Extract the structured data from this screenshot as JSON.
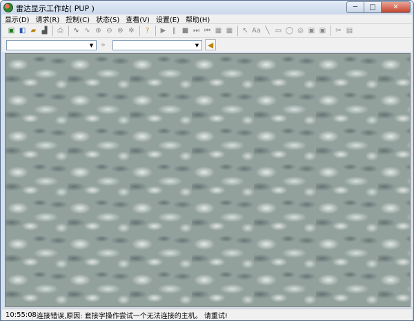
{
  "window": {
    "title": "雷达显示工作站( PUP )",
    "buttons": {
      "minimize": "─",
      "maximize": "□",
      "close": "✕"
    }
  },
  "menu": [
    "显示(D)",
    "请求(R)",
    "控制(C)",
    "状态(S)",
    "查看(V)",
    "设置(E)",
    "帮助(H)"
  ],
  "toolbar": [
    {
      "icon": "open-icon",
      "glyph": "▣"
    },
    {
      "icon": "connect-icon",
      "glyph": "◧"
    },
    {
      "icon": "folder-icon",
      "glyph": "▰"
    },
    {
      "icon": "chart-icon",
      "glyph": "▟"
    },
    {
      "icon": "print-icon",
      "glyph": "⎙"
    },
    {
      "icon": "waveform-icon",
      "glyph": "∿"
    },
    {
      "icon": "waveform-alt-icon",
      "glyph": "∿"
    },
    {
      "icon": "zoom-in-icon",
      "glyph": "⊕"
    },
    {
      "icon": "zoom-out-icon",
      "glyph": "⊖"
    },
    {
      "icon": "zoom-tool-icon",
      "glyph": "⊗"
    },
    {
      "icon": "settings-icon",
      "glyph": "✲"
    },
    {
      "icon": "help-icon",
      "glyph": "?"
    },
    {
      "icon": "play-icon",
      "glyph": "▶"
    },
    {
      "icon": "pause-icon",
      "glyph": "‖"
    },
    {
      "icon": "stop-icon",
      "glyph": "■"
    },
    {
      "icon": "step-forward-icon",
      "glyph": "⏭"
    },
    {
      "icon": "step-back-icon",
      "glyph": "⏮"
    },
    {
      "icon": "grid-icon",
      "glyph": "▦"
    },
    {
      "icon": "grid-alt-icon",
      "glyph": "▦"
    },
    {
      "icon": "pointer-icon",
      "glyph": "↖"
    },
    {
      "icon": "text-icon",
      "glyph": "Aa"
    },
    {
      "icon": "line-icon",
      "glyph": "╲"
    },
    {
      "icon": "rectangle-icon",
      "glyph": "▭"
    },
    {
      "icon": "ellipse-icon",
      "glyph": "◯"
    },
    {
      "icon": "circle-icon",
      "glyph": "◎"
    },
    {
      "icon": "box-icon",
      "glyph": "▣"
    },
    {
      "icon": "box-alt-icon",
      "glyph": "▣"
    },
    {
      "icon": "cut-icon",
      "glyph": "✂"
    },
    {
      "icon": "save-icon",
      "glyph": "▤"
    }
  ],
  "selectors": {
    "left_value": "",
    "right_value": ""
  },
  "status": {
    "time": "10:55:08",
    "message": "连接错误,原因: 套接字操作尝试一个无法连接的主机。    请重试!"
  }
}
